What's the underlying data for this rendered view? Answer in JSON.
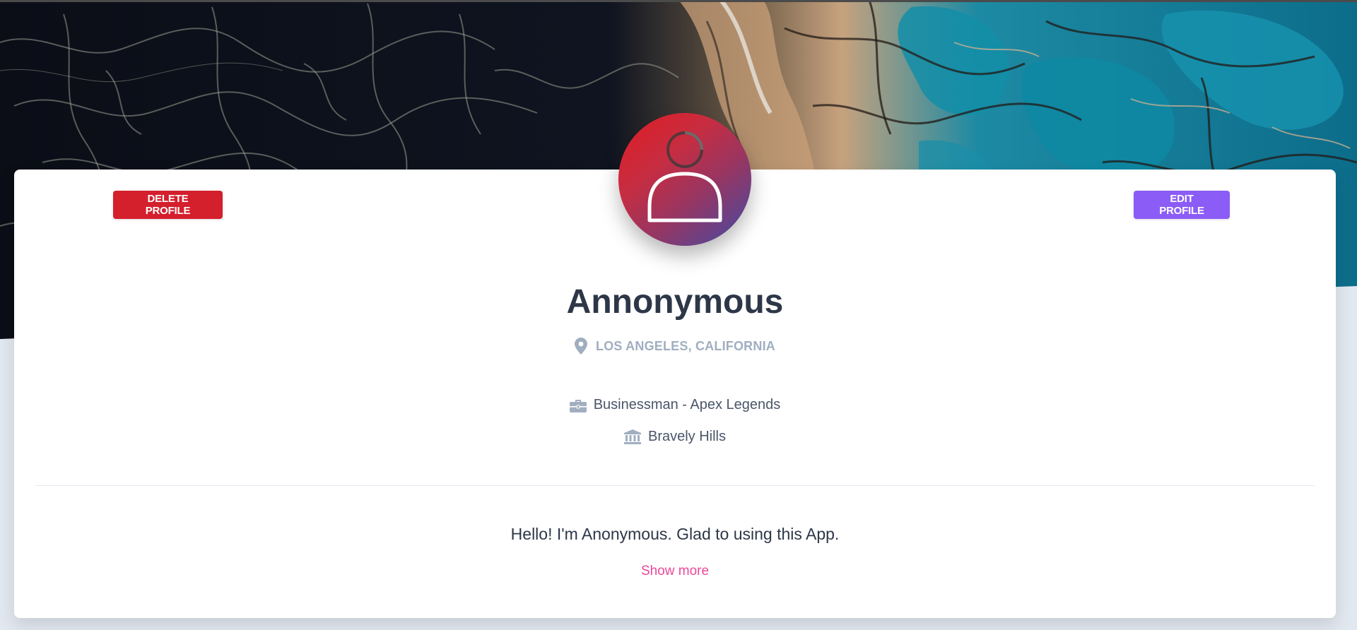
{
  "profile": {
    "name": "Annonymous",
    "location": "Los Angeles, California",
    "job": "Businessman - Apex Legends",
    "school": "Bravely Hills",
    "bio": "Hello! I'm Anonymous. Glad to using this App.",
    "show_more_label": "Show more"
  },
  "actions": {
    "delete_label": "DELETE PROFILE",
    "edit_label": "EDIT PROFILE"
  },
  "icons": {
    "avatar": "user-icon",
    "location": "map-marker-icon",
    "job": "briefcase-icon",
    "school": "university-icon"
  },
  "colors": {
    "delete_button": "#d41f2c",
    "edit_button": "#8b5cf6",
    "show_more_link": "#ec4899",
    "heading": "#2d3748",
    "muted": "#a0aec0"
  }
}
